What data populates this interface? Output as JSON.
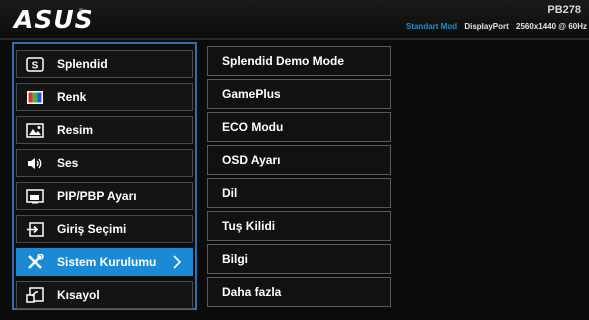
{
  "header": {
    "logo": "ASUS",
    "model": "PB278",
    "mode": "Standart Mod",
    "input": "DisplayPort",
    "resolution": "2560x1440 @ 60Hz"
  },
  "menu": {
    "items": [
      {
        "label": "Splendid",
        "icon": "splendid-icon"
      },
      {
        "label": "Renk",
        "icon": "color-icon"
      },
      {
        "label": "Resim",
        "icon": "image-icon"
      },
      {
        "label": "Ses",
        "icon": "speaker-icon"
      },
      {
        "label": "PIP/PBP Ayarı",
        "icon": "pip-icon"
      },
      {
        "label": "Giriş Seçimi",
        "icon": "input-select-icon"
      },
      {
        "label": "Sistem Kurulumu",
        "icon": "tools-icon",
        "active": true
      },
      {
        "label": "Kısayol",
        "icon": "shortcut-icon"
      }
    ],
    "active_color": "#1a8ad6"
  },
  "submenu": {
    "items": [
      "Splendid Demo Mode",
      "GamePlus",
      "ECO Modu",
      "OSD Ayarı",
      "Dil",
      "Tuş Kilidi",
      "Bilgi",
      "Daha fazla"
    ]
  }
}
